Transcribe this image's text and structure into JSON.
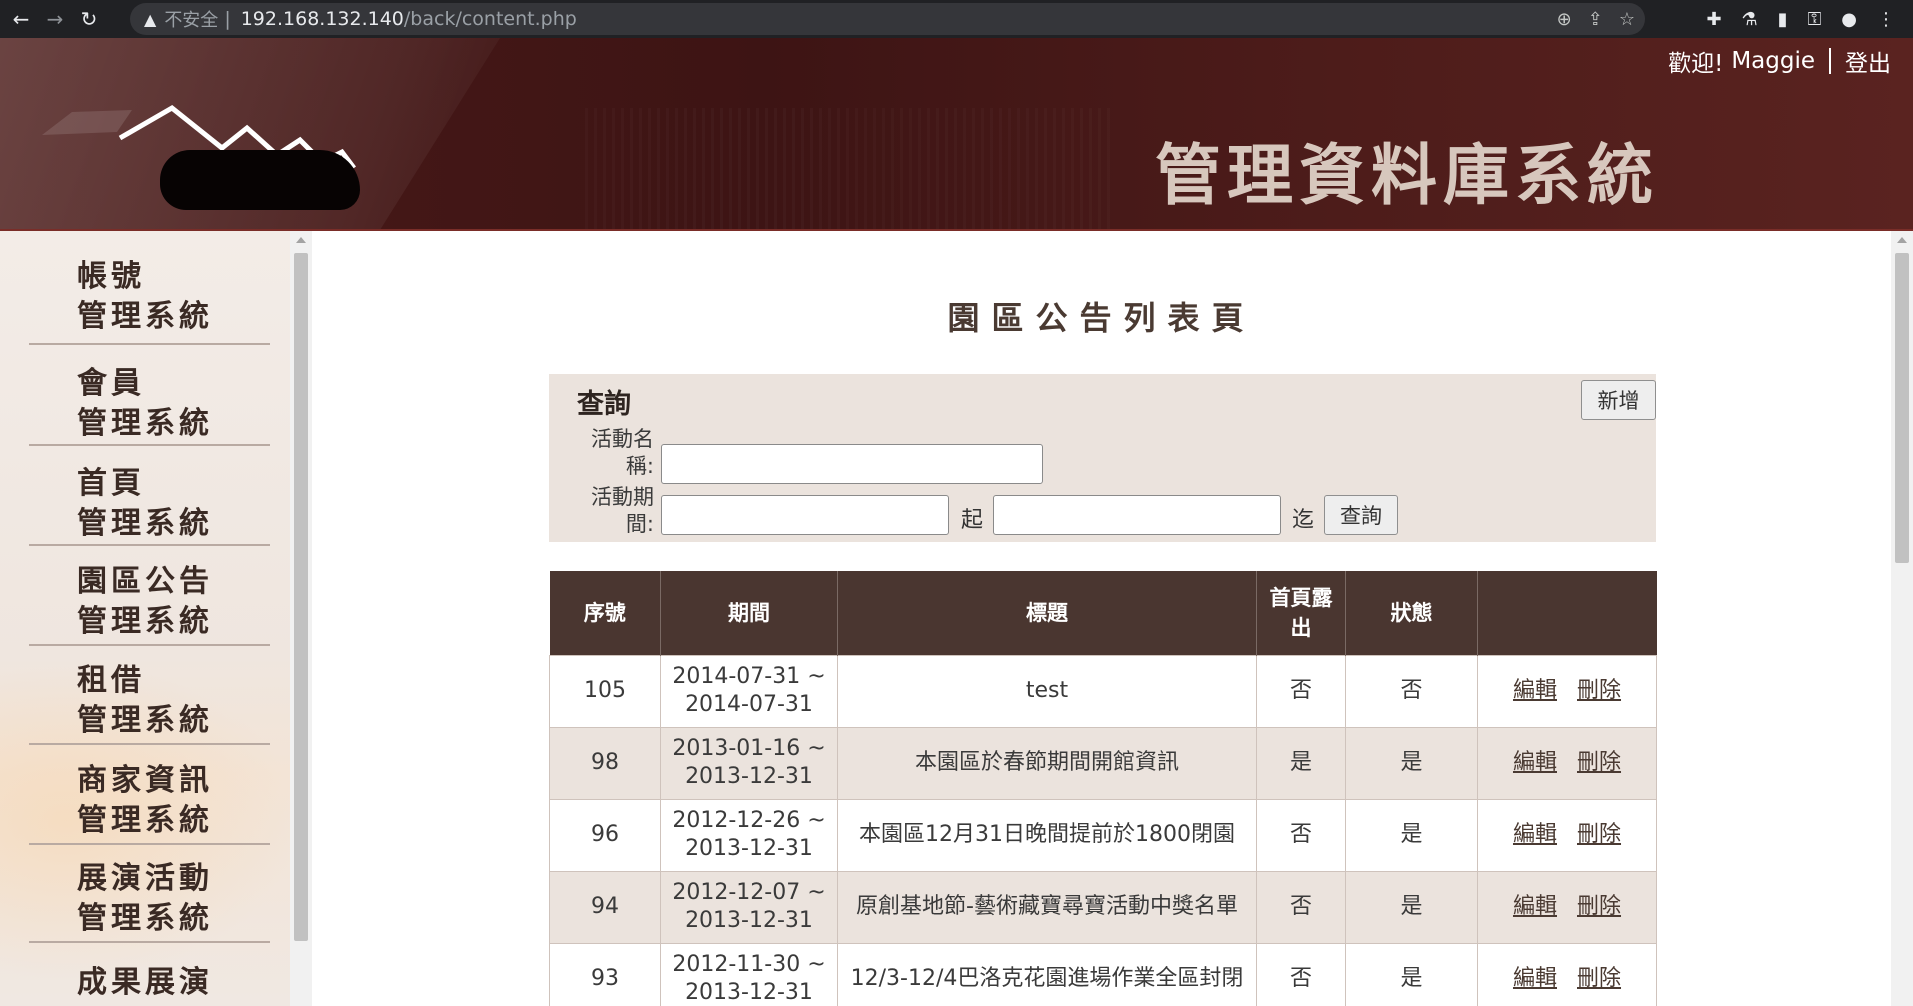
{
  "browser": {
    "insecure_label": "不安全",
    "url_host": "192.168.132.140",
    "url_path": "/back/content.php"
  },
  "header": {
    "system_title": "管理資料庫系統",
    "welcome": "歡迎!",
    "username": "Maggie",
    "logout": "登出"
  },
  "sidebar": {
    "items": [
      {
        "line1": "帳號",
        "line2": "管理系統"
      },
      {
        "line1": "會員",
        "line2": "管理系統"
      },
      {
        "line1": "首頁",
        "line2": "管理系統"
      },
      {
        "line1": "園區公告",
        "line2": "管理系統"
      },
      {
        "line1": "租借",
        "line2": "管理系統"
      },
      {
        "line1": "商家資訊",
        "line2": "管理系統"
      },
      {
        "line1": "展演活動",
        "line2": "管理系統"
      },
      {
        "line1": "成果展演",
        "line2": ""
      }
    ]
  },
  "main": {
    "page_title": "園區公告列表頁",
    "search": {
      "heading": "查詢",
      "add_button": "新增",
      "name_label": "活動名稱:",
      "period_label": "活動期間:",
      "name_value": "",
      "start_value": "",
      "end_value": "",
      "from_word": "起",
      "to_word": "迄",
      "query_button": "查詢"
    },
    "table": {
      "headers": [
        "序號",
        "期間",
        "標題",
        "首頁露出",
        "狀態",
        ""
      ],
      "edit_label": "編輯",
      "delete_label": "刪除",
      "rows": [
        {
          "id": "105",
          "start": "2014-07-31 ~",
          "end": "2014-07-31",
          "title": "test",
          "homepage": "否",
          "status": "否"
        },
        {
          "id": "98",
          "start": "2013-01-16 ~",
          "end": "2013-12-31",
          "title": "本園區於春節期間開館資訊",
          "homepage": "是",
          "status": "是"
        },
        {
          "id": "96",
          "start": "2012-12-26 ~",
          "end": "2013-12-31",
          "title": "本園區12月31日晚間提前於1800閉園",
          "homepage": "否",
          "status": "是"
        },
        {
          "id": "94",
          "start": "2012-12-07 ~",
          "end": "2013-12-31",
          "title": "原創基地節-藝術藏寶尋寶活動中獎名單",
          "homepage": "否",
          "status": "是"
        },
        {
          "id": "93",
          "start": "2012-11-30 ~",
          "end": "2013-12-31",
          "title": "12/3-12/4巴洛克花園進場作業全區封閉",
          "homepage": "否",
          "status": "是"
        }
      ]
    }
  },
  "colors": {
    "banner": "#4a1a18",
    "table_header": "#4a3630",
    "panel_bg": "#ebe3dd"
  }
}
